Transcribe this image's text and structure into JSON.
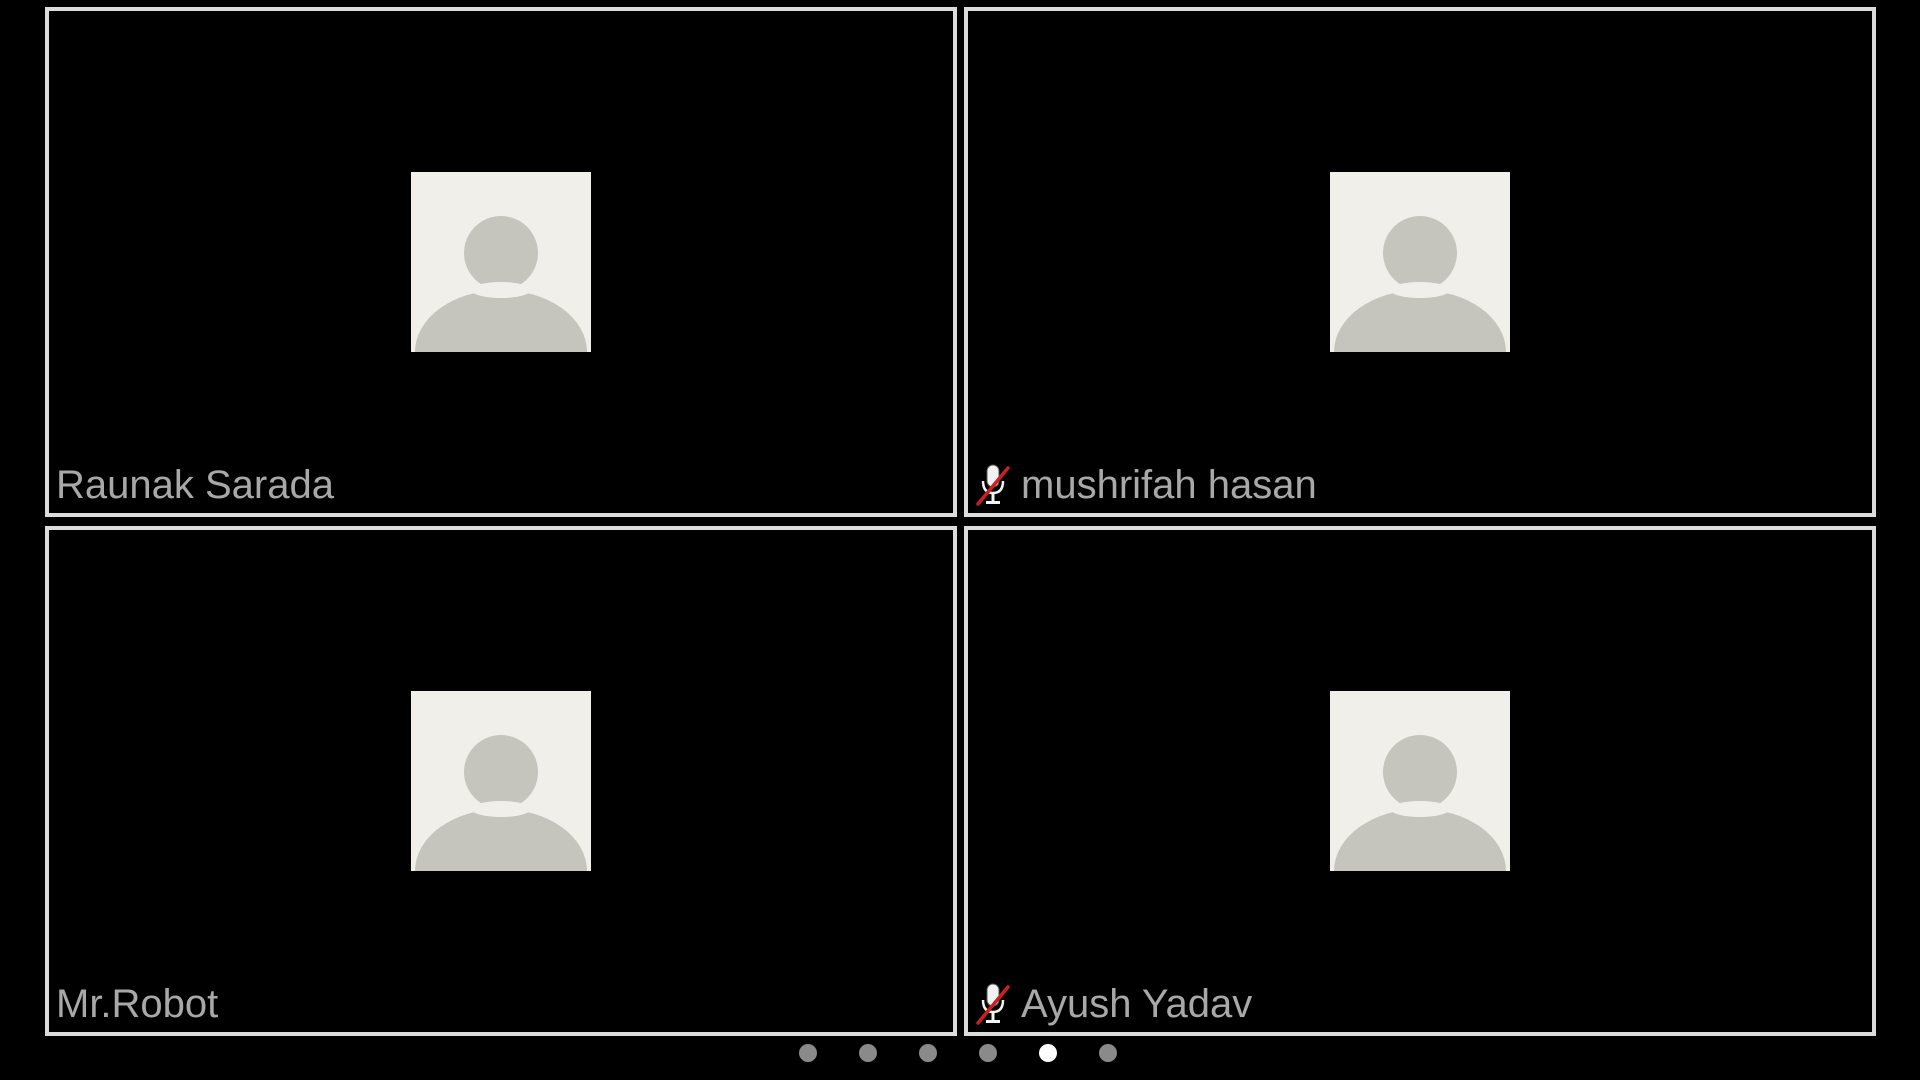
{
  "colors": {
    "background": "#000000",
    "tile_border": "#dcdcdc",
    "avatar_bg": "#f0efea",
    "avatar_figure": "#c5c5bd",
    "name_text": "#a8a8a8",
    "dot_inactive": "#8a8a8a",
    "dot_active": "#ffffff",
    "mute_slash": "#cc1f1f"
  },
  "participants": [
    {
      "name": "Raunak Sarada",
      "muted": false,
      "avatar_icon": "default-avatar-icon"
    },
    {
      "name": "mushrifah hasan",
      "muted": true,
      "avatar_icon": "default-avatar-icon",
      "status_icon": "microphone-muted-icon"
    },
    {
      "name": "Mr.Robot",
      "muted": false,
      "avatar_icon": "default-avatar-icon"
    },
    {
      "name": "Ayush Yadav",
      "muted": true,
      "avatar_icon": "default-avatar-icon",
      "status_icon": "microphone-muted-icon"
    }
  ],
  "pagination": {
    "page_count": 6,
    "active_page": 5
  }
}
